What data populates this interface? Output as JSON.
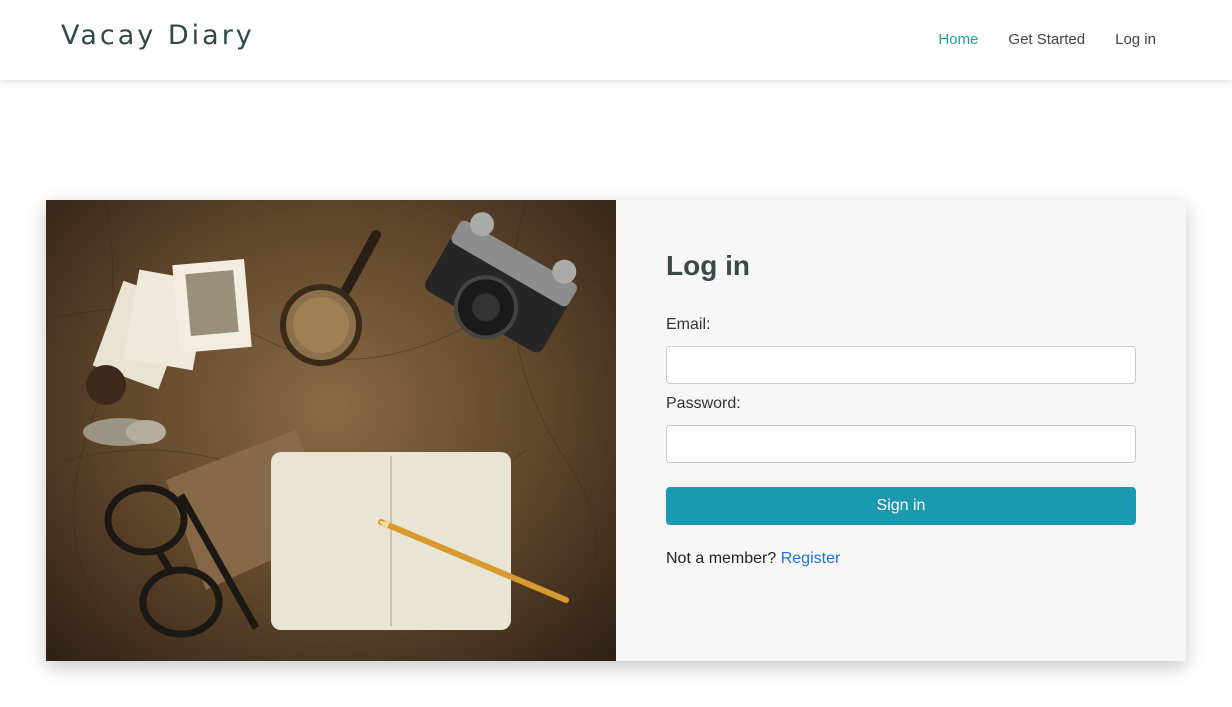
{
  "brand": {
    "name": "Vacay Diary"
  },
  "nav": {
    "items": [
      {
        "label": "Home",
        "active": true
      },
      {
        "label": "Get Started",
        "active": false
      },
      {
        "label": "Log in",
        "active": false
      }
    ]
  },
  "login": {
    "title": "Log in",
    "email_label": "Email:",
    "email_value": "",
    "password_label": "Password:",
    "password_value": "",
    "submit_label": "Sign in",
    "not_member_text": "Not a member?",
    "register_label": "Register"
  },
  "image": {
    "subject": "travel-flatlay"
  },
  "colors": {
    "accent": "#1aa79c",
    "button": "#1a99b0",
    "link": "#1a73d9",
    "panel_bg": "#f7f7f7"
  }
}
